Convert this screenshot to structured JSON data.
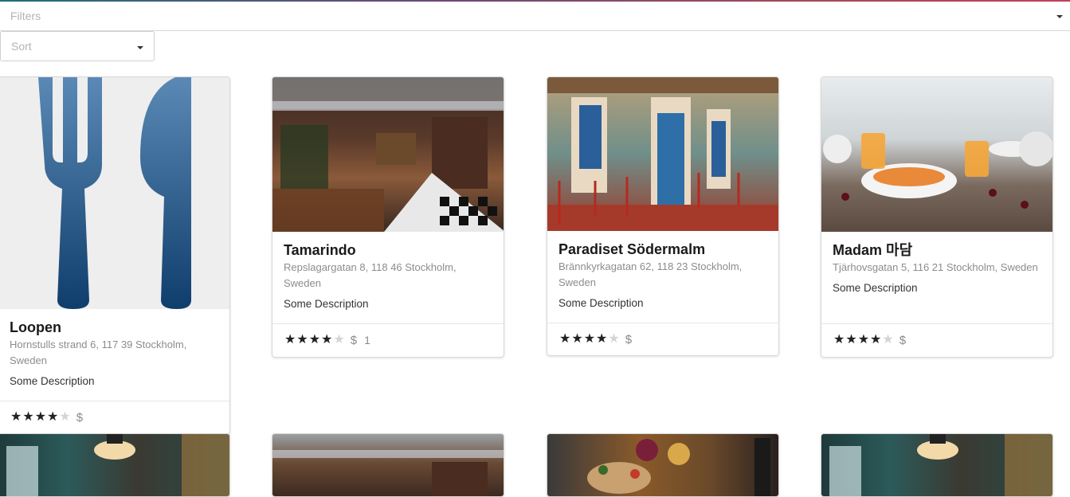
{
  "filters": {
    "placeholder": "Filters"
  },
  "sort": {
    "placeholder": "Sort"
  },
  "colors": {
    "accent_gradient": [
      "#1f6e7a",
      "#6b4a78",
      "#c2405a"
    ],
    "cutlery_icon": "#1e4f7c"
  },
  "restaurants": [
    {
      "name": "Loopen",
      "address": "Hornstulls strand 6, 117 39 Stockholm, Sweden",
      "description": "Some Description",
      "rating": 4,
      "price": "$",
      "review_count": "",
      "image_icon": "fork-knife-icon"
    },
    {
      "name": "Tamarindo",
      "address": "Repslagargatan 8, 118 46 Stockholm, Sweden",
      "description": "Some Description",
      "rating": 4,
      "price": "$",
      "review_count": "1",
      "image_icon": "bar-interior-photo"
    },
    {
      "name": "Paradiset Södermalm",
      "address": "Brännkyrkagatan 62, 118 23 Stockholm, Sweden",
      "description": "Some Description",
      "rating": 4,
      "price": "$",
      "review_count": "",
      "image_icon": "cafe-facade-photo"
    },
    {
      "name": "Madam 마담",
      "address": "Tjärhovsgatan 5, 116 21 Stockholm, Sweden",
      "description": "Some Description",
      "rating": 4,
      "price": "$",
      "review_count": "",
      "image_icon": "breakfast-table-photo"
    }
  ],
  "second_row_images": [
    "cafe-counter-photo",
    "bar-interior-photo",
    "food-platter-photo",
    "cafe-counter-photo"
  ]
}
